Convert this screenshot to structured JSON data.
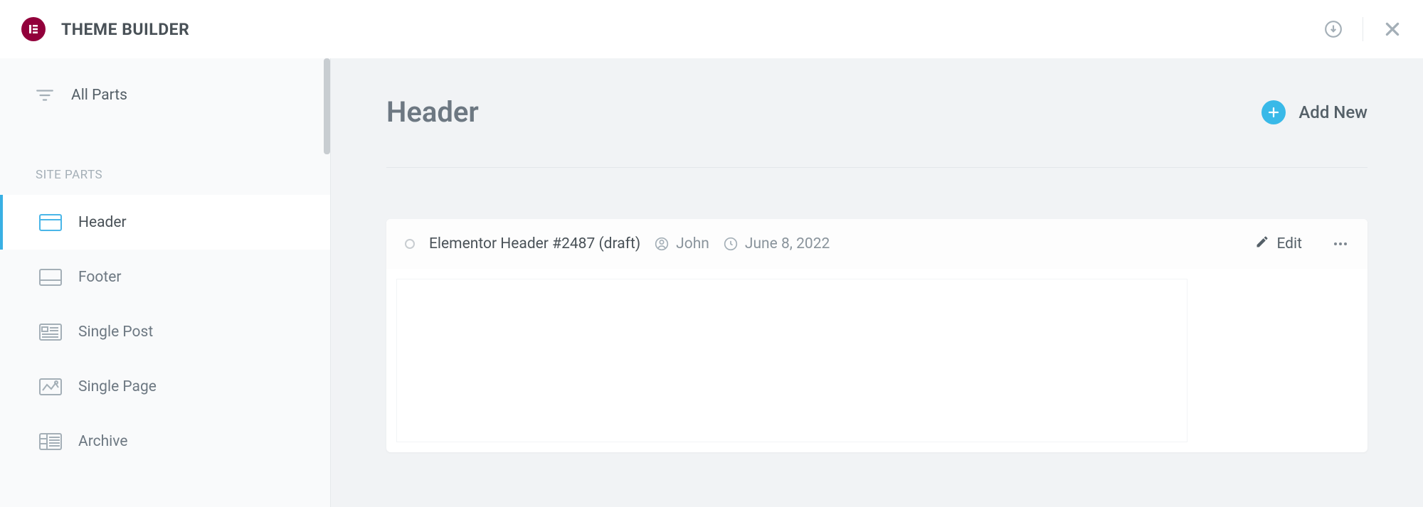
{
  "app": {
    "title": "THEME BUILDER"
  },
  "sidebar": {
    "all_parts_label": "All Parts",
    "section_label": "SITE PARTS",
    "items": [
      {
        "label": "Header"
      },
      {
        "label": "Footer"
      },
      {
        "label": "Single Post"
      },
      {
        "label": "Single Page"
      },
      {
        "label": "Archive"
      }
    ]
  },
  "page": {
    "title": "Header",
    "add_new_label": "Add New"
  },
  "template_card": {
    "title": "Elementor Header #2487 (draft)",
    "author": "John",
    "date": "June 8, 2022",
    "edit_label": "Edit"
  }
}
